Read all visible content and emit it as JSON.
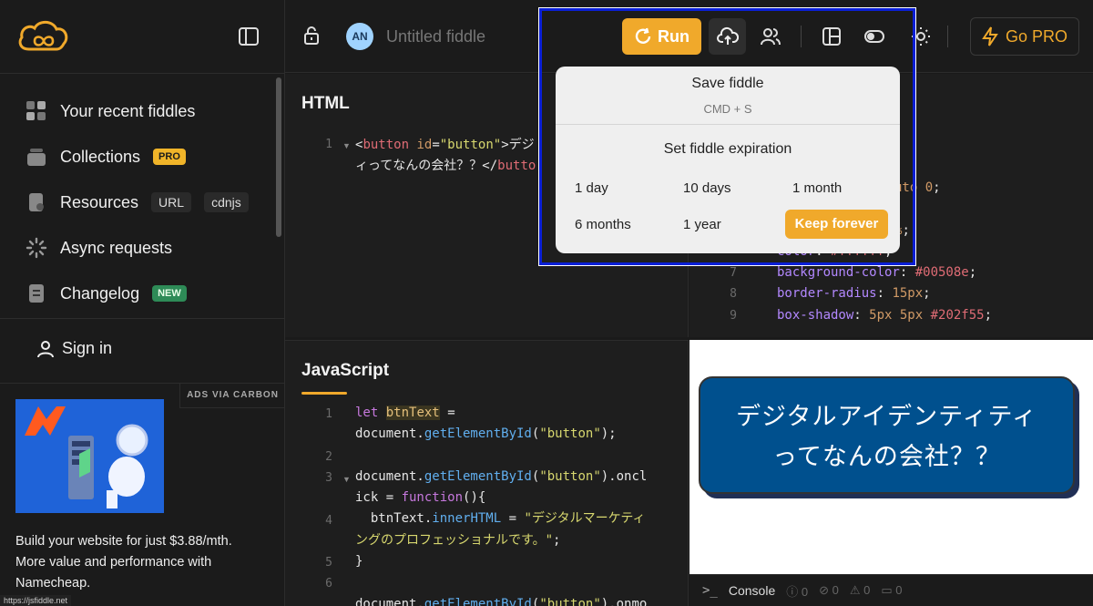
{
  "sidebar": {
    "items": [
      {
        "label": "Your recent fiddles"
      },
      {
        "label": "Collections",
        "badge": "PRO"
      },
      {
        "label": "Resources",
        "tags": [
          "URL",
          "cdnjs"
        ]
      },
      {
        "label": "Async requests"
      },
      {
        "label": "Changelog",
        "badge": "NEW"
      }
    ],
    "sign_in": "Sign in",
    "ads_label": "ADS VIA CARBON",
    "ad_text": "Build your website for just $3.88/mth. More value and performance with Namecheap.",
    "status_url": "https://jsfiddle.net"
  },
  "header": {
    "avatar": "AN",
    "title_placeholder": "Untitled fiddle",
    "run_label": "Run",
    "gopro_label": "Go PRO"
  },
  "popover": {
    "save_label": "Save fiddle",
    "save_shortcut": "CMD + S",
    "expiration_title": "Set fiddle expiration",
    "options": [
      "1 day",
      "10 days",
      "1 month",
      "6 months",
      "1 year",
      "Keep forever"
    ],
    "selected": "Keep forever"
  },
  "panels": {
    "html_title": "HTML",
    "js_title": "JavaScript"
  },
  "result": {
    "button_text_line1": "デジタルアイデンティティ",
    "button_text_line2": "ってなんの会社？？"
  },
  "console": {
    "label": "Console",
    "counts": [
      "0",
      "0",
      "0",
      "0"
    ]
  },
  "colors": {
    "accent": "#f0a92b",
    "result_button_bg": "#00508e",
    "result_button_shadow": "#202f55"
  }
}
